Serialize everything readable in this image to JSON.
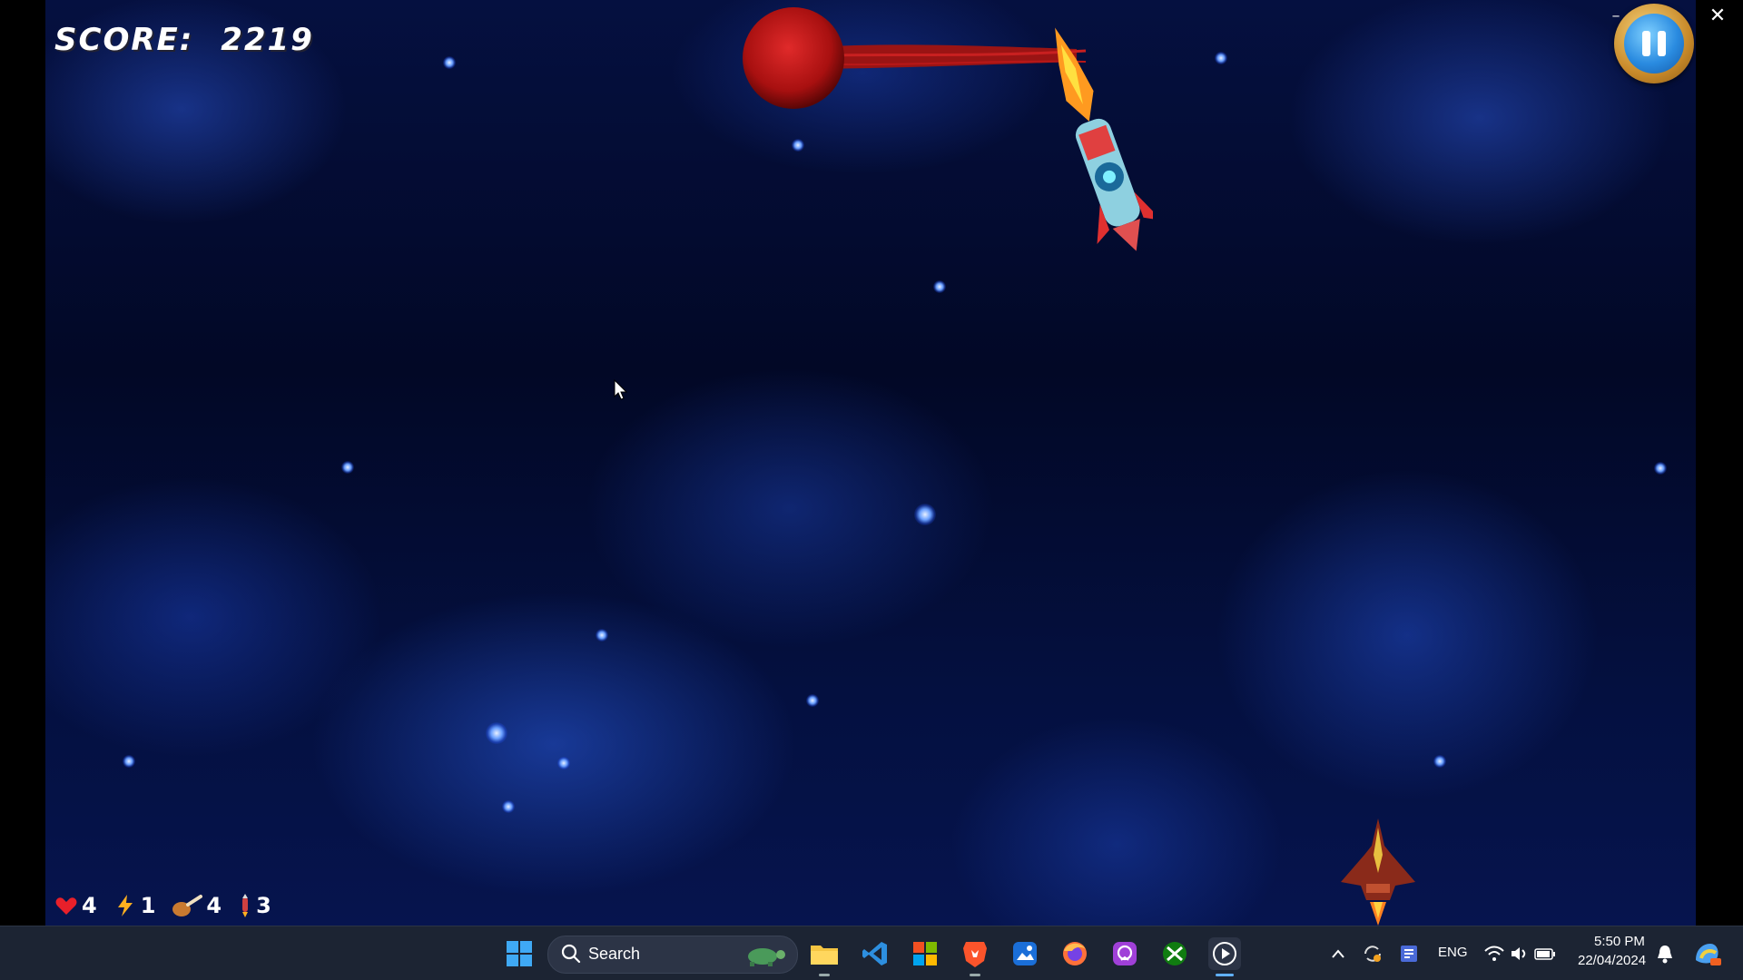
{
  "hud": {
    "score_label": "SCORE:",
    "score_value": "2219",
    "lives": "4",
    "power": "1",
    "food": "4",
    "missiles": "3"
  },
  "taskbar": {
    "search_label": "Search",
    "language": "ENG",
    "time": "5:50 PM",
    "date": "22/04/2024",
    "icons": [
      "windows-start-icon",
      "search-icon",
      "file-explorer-icon",
      "vscode-icon",
      "microsoft-store-icon",
      "brave-icon",
      "photos-icon",
      "firefox-icon",
      "messenger-icon",
      "xbox-icon",
      "media-player-icon"
    ]
  },
  "colors": {
    "space_dark": "#020826",
    "nebula_blue": "#2850c8",
    "taskbar_bg": "#1c2433",
    "pause_ring": "#c98a2a",
    "pause_core": "#2a8be0",
    "enemy_red": "#b01818"
  }
}
